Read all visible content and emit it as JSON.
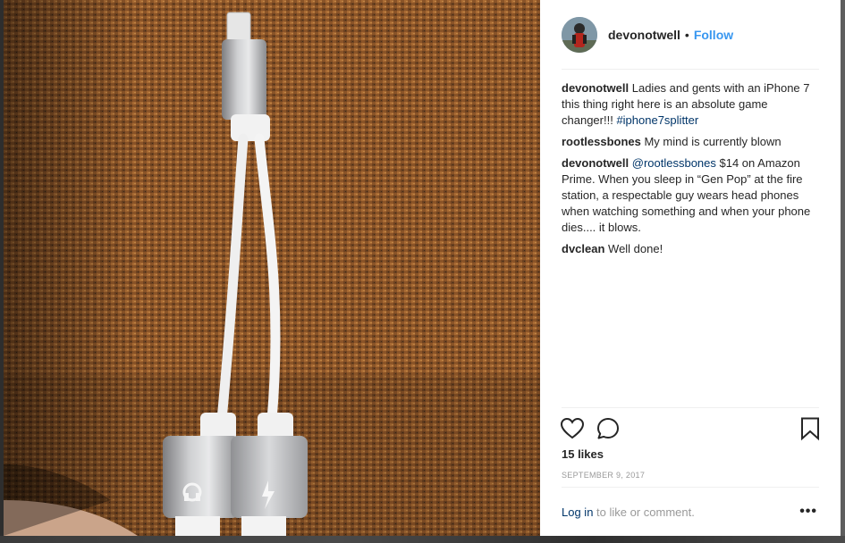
{
  "post": {
    "username": "devonotwell",
    "separator": "•",
    "follow_label": "Follow"
  },
  "comments": [
    {
      "user": "devonotwell",
      "text_before": " Ladies and gents with an iPhone 7 this thing right here is an absolute game changer!!! ",
      "hashtag": "#iphone7splitter"
    },
    {
      "user": "rootlessbones",
      "text": " My mind is currently blown"
    },
    {
      "user": "devonotwell",
      "mention": "@rootlessbones",
      "text_after": " $14 on Amazon Prime. When you sleep in “Gen Pop” at the fire station, a respectable guy wears head phones when watching something and when your phone dies.... it blows."
    },
    {
      "user": "dvclean",
      "text": " Well done!"
    }
  ],
  "engagement": {
    "likes_label": "15 likes",
    "date_label": "SEPTEMBER 9, 2017"
  },
  "footer": {
    "login_link": "Log in",
    "login_suffix": " to like or comment.",
    "more_label": "•••"
  },
  "icons": {
    "like": "heart-icon",
    "comment": "comment-bubble-icon",
    "save": "bookmark-icon",
    "more": "ellipsis-icon"
  },
  "colors": {
    "accent": "#3897f0",
    "link": "#003569",
    "text": "#262626",
    "muted": "#999999"
  }
}
